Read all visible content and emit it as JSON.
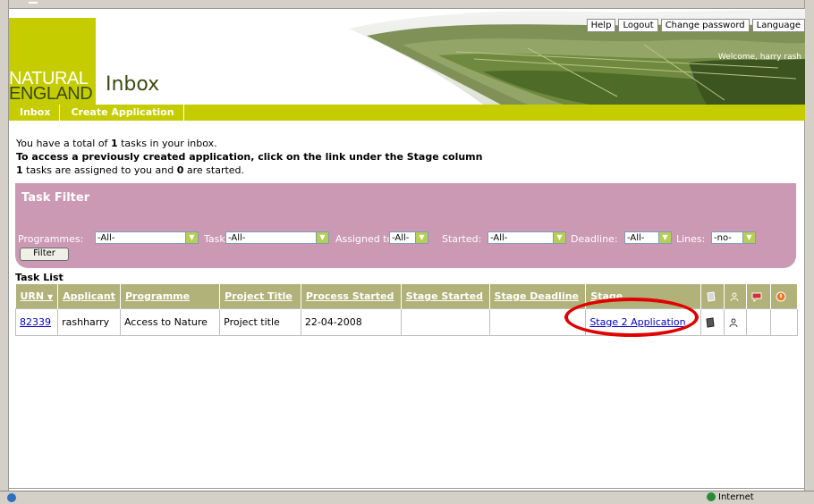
{
  "header": {
    "logo_line1": "NATURAL",
    "logo_line2": "ENGLAND",
    "title": "Inbox",
    "top_links": [
      "Help",
      "Logout",
      "Change password",
      "Language"
    ],
    "welcome": "Welcome, harry rash"
  },
  "nav": {
    "items": [
      "Inbox",
      "Create Application"
    ]
  },
  "intro": {
    "line1_a": "You have a total of ",
    "line1_count": "1",
    "line1_b": " tasks in your inbox.",
    "line2": "To access a previously created application, click on the link under the Stage column",
    "line3_count1": "1",
    "line3_a": " tasks are assigned to you and ",
    "line3_count2": "0",
    "line3_b": " are started."
  },
  "filter": {
    "title": "Task Filter",
    "programmes_label": "Programmes:",
    "programmes_value": "-All-",
    "task_label": "Task:",
    "task_value": "-All-",
    "assigned_label": "Assigned to:",
    "assigned_value": "-All-",
    "started_label": "Started:",
    "started_value": "-All-",
    "deadline_label": "Deadline:",
    "deadline_value": "-All-",
    "lines_label": "Lines:",
    "lines_value": "-no-",
    "button": "Filter"
  },
  "task_list": {
    "label": "Task List",
    "columns": [
      "URN",
      "Applicant",
      "Programme",
      "Project Title",
      "Process Started",
      "Stage Started",
      "Stage Deadline",
      "Stage"
    ],
    "rows": [
      {
        "urn": "82339",
        "applicant": "rashharry",
        "programme": "Access to Nature",
        "project_title": "Project title",
        "process_started": "22-04-2008",
        "stage_started": "",
        "stage_deadline": "",
        "stage": "Stage 2 Application"
      }
    ],
    "icon_columns": [
      "note-icon",
      "assign-icon",
      "comment-icon",
      "alert-icon"
    ]
  },
  "status_bar": {
    "zone": "Internet"
  },
  "colors": {
    "brand_green": "#c5cd00",
    "dark_green": "#3c4a12",
    "filter_pink": "#cc99b5",
    "table_header": "#b0b279",
    "highlight_red": "#e00000"
  }
}
